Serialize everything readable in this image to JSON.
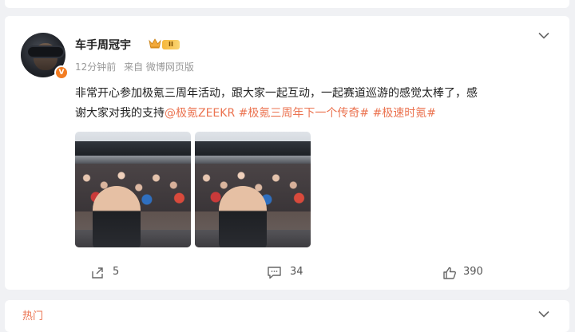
{
  "post": {
    "author": "车手周冠宇",
    "level": "II",
    "verified_mark": "V",
    "time": "12分钟前",
    "source": "来自 微博网页版",
    "text_line1": "非常开心参加极氪三周年活动，跟大家一起互动，一起赛道巡游的感觉太棒了，感",
    "text_line2_plain": "谢大家对我的支持",
    "mention": "@极氪ZEEKR",
    "hashtags": [
      "#极氪三周年下一个传奇#",
      "#极速时氪#"
    ]
  },
  "actions": {
    "repost_count": "5",
    "comment_count": "34",
    "like_count": "390"
  },
  "hot": {
    "title": "热门"
  },
  "colors": {
    "accent": "#eb7350",
    "background": "#f0f1f4",
    "verified": "#f27c22"
  },
  "icons": [
    "crown-icon",
    "chevron-down-icon",
    "repost-icon",
    "comment-icon",
    "like-icon"
  ]
}
